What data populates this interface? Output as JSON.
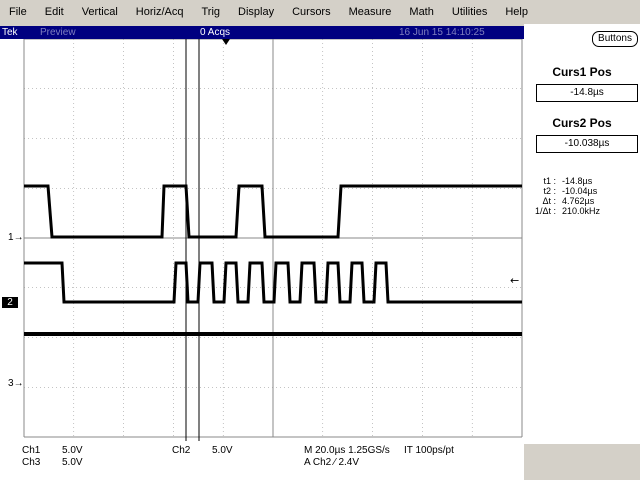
{
  "menu": [
    "File",
    "Edit",
    "Vertical",
    "Horiz/Acq",
    "Trig",
    "Display",
    "Cursors",
    "Measure",
    "Math",
    "Utilities",
    "Help"
  ],
  "titlebar": {
    "brand": "Tek",
    "mode": "Preview",
    "acqs": "0 Acqs",
    "datetime": "16 Jun 15 14:10:25"
  },
  "right_panel": {
    "buttons_label": "Buttons",
    "curs1_label": "Curs1 Pos",
    "curs1_value": "-14.8µs",
    "curs2_label": "Curs2 Pos",
    "curs2_value": "-10.038µs",
    "measurements": [
      {
        "label": "t1 :",
        "value": "-14.8µs"
      },
      {
        "label": "t2 :",
        "value": "-10.04µs"
      },
      {
        "label": "Δt :",
        "value": "4.762µs"
      },
      {
        "label": "1/Δt :",
        "value": "210.0kHz"
      }
    ]
  },
  "channel_markers": {
    "ch1": "1",
    "ch2": "2",
    "ch3": "3"
  },
  "status": {
    "ch1_label": "Ch1",
    "ch1_scale": "5.0V",
    "ch3_label": "Ch3",
    "ch3_scale": "5.0V",
    "ch2_label": "Ch2",
    "ch2_scale": "5.0V",
    "timebase": "M 20.0µs 1.25GS/s",
    "resolution": "IT 100ps/pt",
    "trigger": "A  Ch2  ⁄  2.4V"
  },
  "colors": {
    "menubar": "#d4d0c8",
    "titlebar": "#000080",
    "grid": "#888888",
    "trace": "#000000"
  }
}
